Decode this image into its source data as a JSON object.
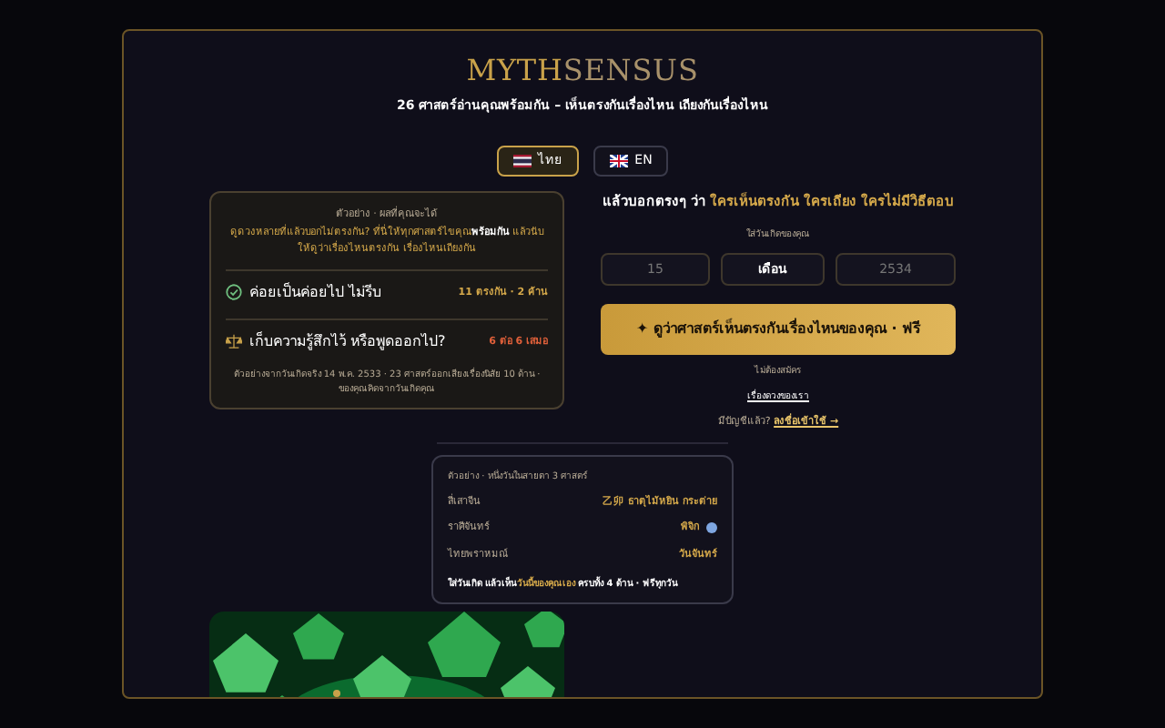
{
  "logo": {
    "first": "MYTH",
    "second": "SENSUS"
  },
  "subtitle": "26 ศาสตร์อ่านคุณพร้อมกัน – เห็นตรงกันเรื่องไหน เถียงกันเรื่องไหน",
  "languages": [
    {
      "kind": "th",
      "label": "ไทย",
      "selected": true
    },
    {
      "kind": "gb",
      "label": "EN",
      "selected": false
    }
  ],
  "example_card": {
    "header": "ตัวอย่าง · ผลที่คุณจะได้",
    "intro": "ดูดวงหลายที่แล้วบอกไม่ตรงกัน? ที่นี่ให้ทุกศาสตร์ไขคุณ**พร้อมกัน** แล้วนับให้ดูว่าเรื่องไหนตรงกัน เรื่องไหนเถียงกัน",
    "rows": [
      {
        "kind": "agree",
        "text": "ค่อยเป็นค่อยไป ไม่รีบ",
        "score": "11 ตรงกัน · 2 ค้าน"
      },
      {
        "kind": "split",
        "text": "เก็บความรู้สึกไว้ หรือพูดออกไป?",
        "score": "6 ต่อ 6 เสมอ"
      }
    ],
    "footnote": "ตัวอย่างจากวันเกิดจริง 14 พ.ค. 2533 · 23 ศาสตร์ออกเสียงเรื่องนิสัย 10 ด้าน · ของคุณคิดจากวันเกิดคุณ"
  },
  "pitch": {
    "lead": "แล้วบอกตรงๆ ว่า ",
    "highlight": "ใครเห็นตรงกัน ใครเถียง ใครไม่มีวิธีตอบ"
  },
  "birth_form": {
    "label": "ใส่วันเกิดของคุณ",
    "day": {
      "placeholder": "15"
    },
    "month": {
      "value": "เดือน"
    },
    "year": {
      "placeholder": "2534"
    }
  },
  "cta_button": "✦ ดูว่าศาสตร์เห็นตรงกันเรื่องไหนของคุณ · ฟรี",
  "no_signup": "ไม่ต้องสมัคร",
  "about_link": "เรื่องดวงของเรา",
  "login": {
    "prompt": "มีบัญชีแล้ว? ",
    "link": "ลงชื่อเข้าใช้ →"
  },
  "day_card": {
    "header": "ตัวอย่าง · หนึ่งวันในสายตา 3 ศาสตร์",
    "rows": [
      {
        "label": "สี่เสาจีน",
        "value": "乙卯 ธาตุไม้หยิน กระต่าย"
      },
      {
        "label": "ราศีจันทร์",
        "value": "พิจิก",
        "color": "#7ea6e0"
      },
      {
        "label": "ไทยพราหมณ์",
        "value": "วันจันทร์"
      }
    ],
    "footer_lead": "ใส่วันเกิด แล้วเห็น",
    "footer_highlight": "วันนี้ของคุณเอง",
    "footer_tail": " ครบทั้ง 4 ด้าน · ฟรีทุกวัน"
  }
}
